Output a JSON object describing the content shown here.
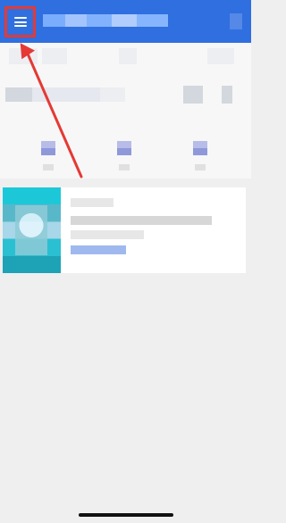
{
  "app": {
    "colors": {
      "primary": "#2f6fe0",
      "annotation": "#e53935",
      "background": "#efefef"
    }
  },
  "header": {
    "menu_icon": "hamburger-menu-icon"
  },
  "annotation": {
    "arrow_color": "#e53935",
    "highlight_color": "#e53935"
  }
}
